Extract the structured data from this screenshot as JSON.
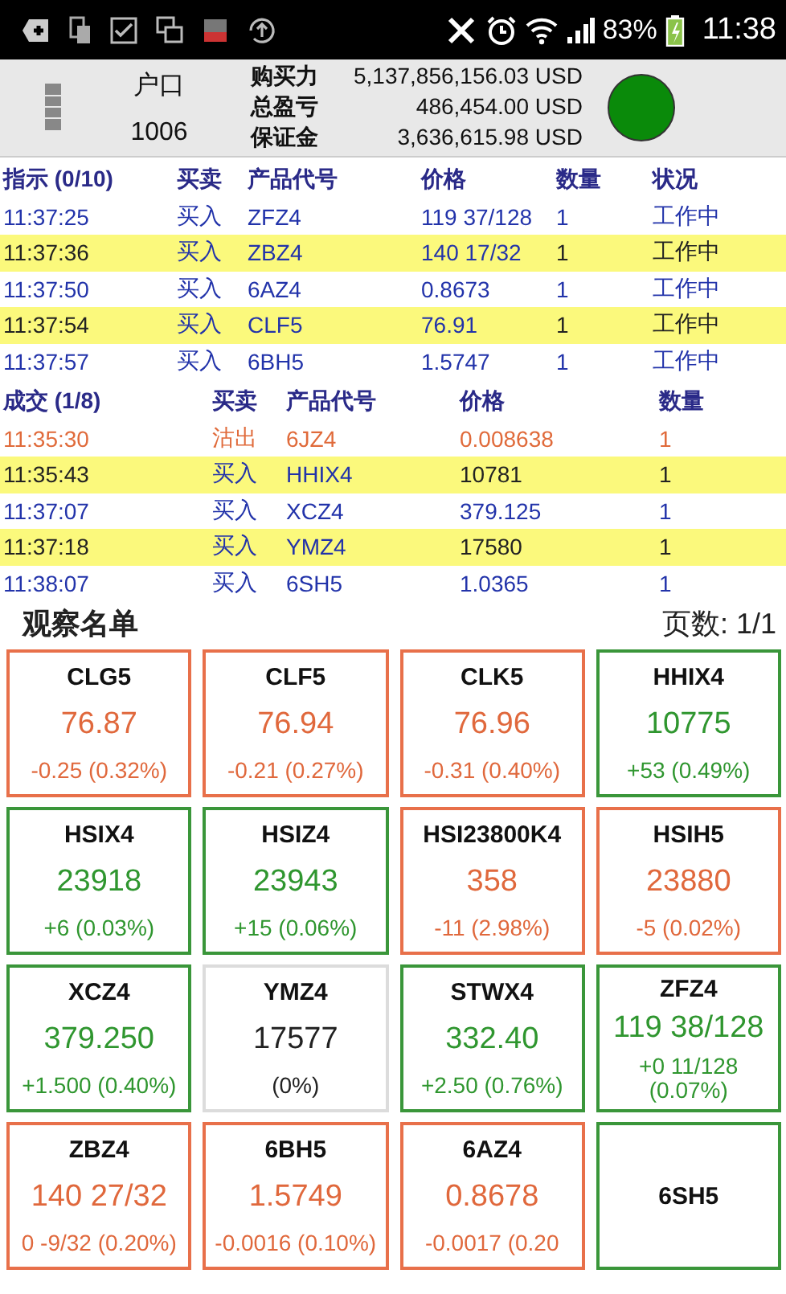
{
  "status_bar": {
    "battery": "83%",
    "time": "11:38"
  },
  "account": {
    "label": "户口",
    "number": "1006",
    "connected": true,
    "fields": [
      {
        "label": "购买力",
        "value": "5,137,856,156.03 USD"
      },
      {
        "label": "总盈亏",
        "value": "486,454.00 USD"
      },
      {
        "label": "保证金",
        "value": "3,636,615.98 USD"
      }
    ]
  },
  "orders": {
    "title": "指示 (0/10)",
    "columns": [
      "买卖",
      "产品代号",
      "价格",
      "数量",
      "状况"
    ],
    "rows": [
      {
        "time": "11:37:25",
        "side": "买入",
        "symbol": "ZFZ4",
        "price": "119 37/128",
        "qty": "1",
        "status": "工作中"
      },
      {
        "time": "11:37:36",
        "side": "买入",
        "symbol": "ZBZ4",
        "price": "140 17/32",
        "qty": "1",
        "status": "工作中"
      },
      {
        "time": "11:37:50",
        "side": "买入",
        "symbol": "6AZ4",
        "price": "0.8673",
        "qty": "1",
        "status": "工作中"
      },
      {
        "time": "11:37:54",
        "side": "买入",
        "symbol": "CLF5",
        "price": "76.91",
        "qty": "1",
        "status": "工作中"
      },
      {
        "time": "11:37:57",
        "side": "买入",
        "symbol": "6BH5",
        "price": "1.5747",
        "qty": "1",
        "status": "工作中"
      }
    ]
  },
  "trades": {
    "title": "成交 (1/8)",
    "columns": [
      "买卖",
      "产品代号",
      "价格",
      "数量"
    ],
    "rows": [
      {
        "kind": "sell",
        "time": "11:35:30",
        "side": "沽出",
        "symbol": "6JZ4",
        "price": "0.008638",
        "qty": "1"
      },
      {
        "kind": "buy",
        "time": "11:35:43",
        "side": "买入",
        "symbol": "HHIX4",
        "price": "10781",
        "qty": "1"
      },
      {
        "kind": "buy",
        "time": "11:37:07",
        "side": "买入",
        "symbol": "XCZ4",
        "price": "379.125",
        "qty": "1"
      },
      {
        "kind": "buy",
        "time": "11:37:18",
        "side": "买入",
        "symbol": "YMZ4",
        "price": "17580",
        "qty": "1"
      },
      {
        "kind": "buy",
        "time": "11:38:07",
        "side": "买入",
        "symbol": "6SH5",
        "price": "1.0365",
        "qty": "1"
      }
    ]
  },
  "watchlist": {
    "title": "观察名单",
    "page": "页数: 1/1",
    "tiles": [
      {
        "kind": "down",
        "symbol": "CLG5",
        "price": "76.87",
        "change": "-0.25 (0.32%)"
      },
      {
        "kind": "down",
        "symbol": "CLF5",
        "price": "76.94",
        "change": "-0.21 (0.27%)"
      },
      {
        "kind": "down",
        "symbol": "CLK5",
        "price": "76.96",
        "change": "-0.31 (0.40%)"
      },
      {
        "kind": "up",
        "symbol": "HHIX4",
        "price": "10775",
        "change": "+53 (0.49%)"
      },
      {
        "kind": "up",
        "symbol": "HSIX4",
        "price": "23918",
        "change": "+6 (0.03%)"
      },
      {
        "kind": "up",
        "symbol": "HSIZ4",
        "price": "23943",
        "change": "+15 (0.06%)"
      },
      {
        "kind": "down",
        "symbol": "HSI23800K4",
        "price": "358",
        "change": "-11 (2.98%)"
      },
      {
        "kind": "down",
        "symbol": "HSIH5",
        "price": "23880",
        "change": "-5 (0.02%)"
      },
      {
        "kind": "up",
        "symbol": "XCZ4",
        "price": "379.250",
        "change": "+1.500 (0.40%)"
      },
      {
        "kind": "flat",
        "symbol": "YMZ4",
        "price": "17577",
        "change": "(0%)"
      },
      {
        "kind": "up",
        "symbol": "STWX4",
        "price": "332.40",
        "change": "+2.50 (0.76%)"
      },
      {
        "kind": "up",
        "symbol": "ZFZ4",
        "price": "119 38/128",
        "change": "+0 11/128 (0.07%)"
      },
      {
        "kind": "down",
        "symbol": "ZBZ4",
        "price": "140 27/32",
        "change": "0 -9/32 (0.20%)"
      },
      {
        "kind": "down",
        "symbol": "6BH5",
        "price": "1.5749",
        "change": "-0.0016 (0.10%)"
      },
      {
        "kind": "down",
        "symbol": "6AZ4",
        "price": "0.8678",
        "change": "-0.0017 (0.20"
      },
      {
        "kind": "up",
        "symbol": "6SH5"
      }
    ]
  }
}
